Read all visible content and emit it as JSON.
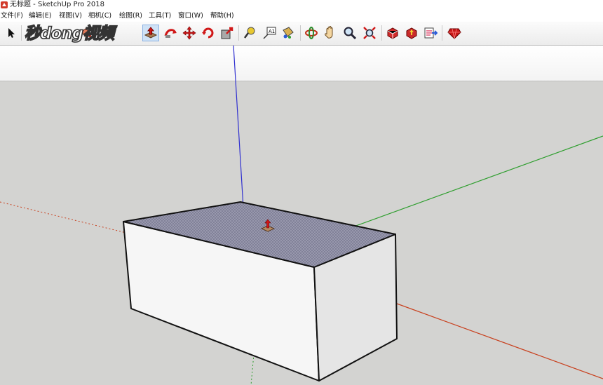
{
  "window": {
    "title": "无标题 - SketchUp Pro 2018"
  },
  "menubar": {
    "items": [
      "文件(F)",
      "编辑(E)",
      "视图(V)",
      "相机(C)",
      "绘图(R)",
      "工具(T)",
      "窗口(W)",
      "帮助(H)"
    ]
  },
  "toolbar": {
    "tools": [
      {
        "name": "select-tool-icon"
      },
      {
        "name": "paint-bucket-icon"
      },
      {
        "name": "push-pull-icon",
        "active": true
      },
      {
        "name": "follow-me-icon"
      },
      {
        "name": "move-icon"
      },
      {
        "name": "rotate-icon"
      },
      {
        "name": "scale-icon"
      },
      {
        "name": "tape-measure-icon"
      },
      {
        "name": "text-icon"
      },
      {
        "name": "paint-icon"
      },
      {
        "name": "orbit-icon"
      },
      {
        "name": "pan-icon"
      },
      {
        "name": "zoom-icon"
      },
      {
        "name": "zoom-extents-icon"
      },
      {
        "name": "warehouse-icon"
      },
      {
        "name": "share-model-icon"
      },
      {
        "name": "extension-warehouse-icon"
      },
      {
        "name": "ruby-icon"
      }
    ]
  },
  "watermark": {
    "text": "秒dong视频"
  },
  "colors": {
    "sky": "#ffffff",
    "ground": "#d4d4d2",
    "red_axis": "#c8401e",
    "green_axis": "#2e9e2e",
    "blue_axis": "#3030d0",
    "box_face": "#f6f6f6",
    "box_top": "#8e8ea4"
  }
}
